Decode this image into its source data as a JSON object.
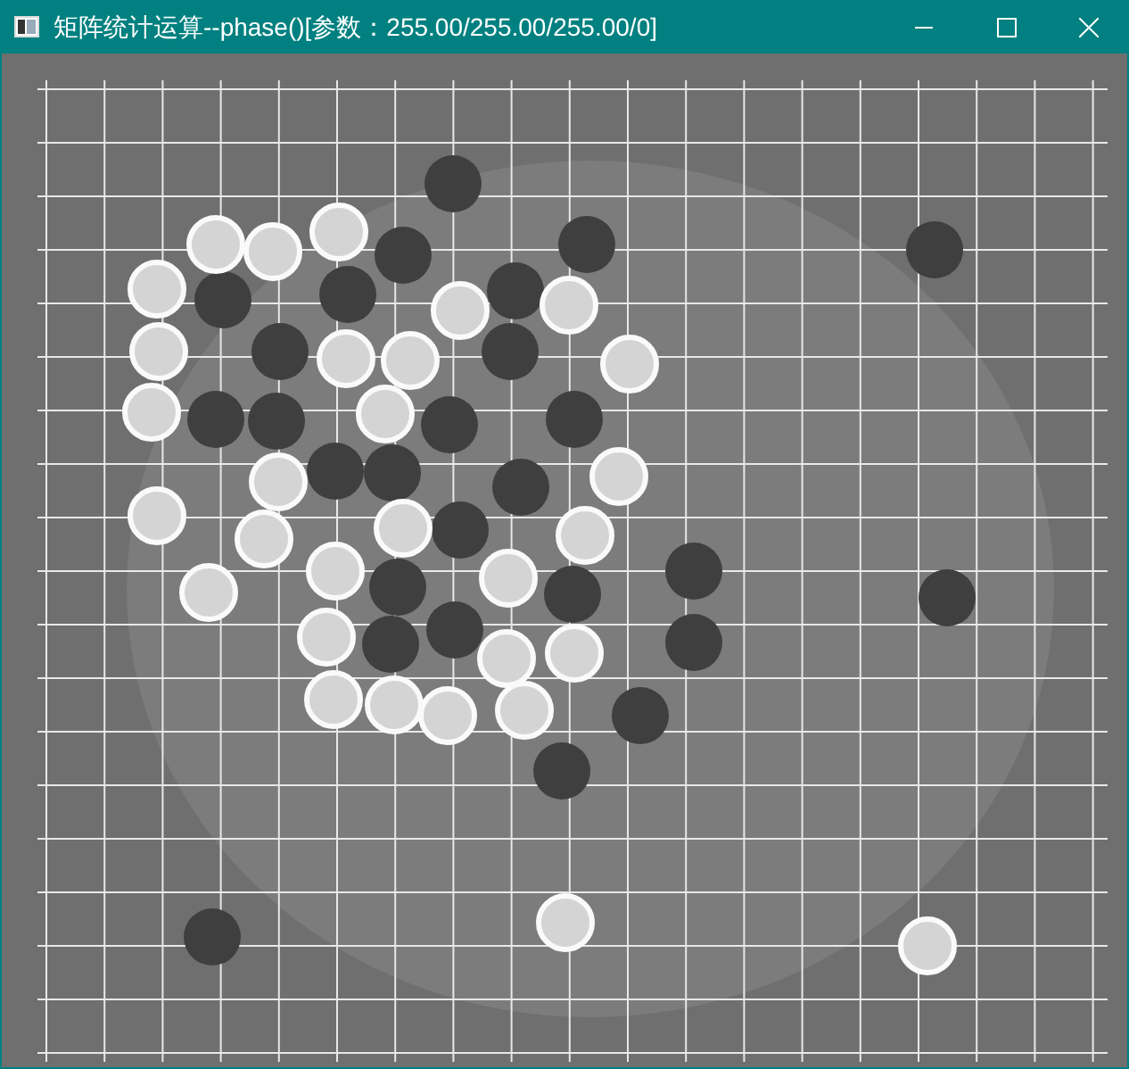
{
  "window": {
    "title": "矩阵统计运算--phase()[参数：255.00/255.00/255.00/0]"
  }
}
